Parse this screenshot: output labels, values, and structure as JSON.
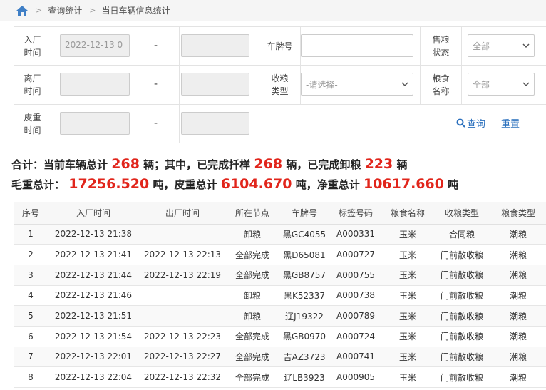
{
  "breadcrumb": {
    "items": [
      "查询统计",
      "当日车辆信息统计"
    ]
  },
  "filters": {
    "entry_time": {
      "label": "入厂时间",
      "from_value": "2022-12-13 0",
      "to_value": ""
    },
    "exit_time": {
      "label": "离厂时间",
      "from_value": "",
      "to_value": ""
    },
    "tare_time": {
      "label": "皮重时间",
      "from_value": "",
      "to_value": ""
    },
    "range_sep": "-",
    "plate": {
      "label": "车牌号",
      "value": ""
    },
    "grain_type_recv": {
      "label": "收粮类型",
      "placeholder": "-请选择-"
    },
    "sale_status": {
      "label": "售粮状态",
      "value": "全部"
    },
    "grain_name": {
      "label": "粮食名称",
      "value": "全部"
    },
    "query_label": "查询",
    "reset_label": "重置"
  },
  "summary": {
    "p1": "合计：当前车辆总计",
    "total_vehicles": "268",
    "u1": "辆；其中，已完成扦样",
    "sampled": "268",
    "u2": "辆，已完成卸粮",
    "unloaded": "223",
    "u3": "辆",
    "p2": "毛重总计：",
    "gross": "17256.520",
    "u4": "吨，皮重总计",
    "tare": "6104.670",
    "u5": "吨，净重总计",
    "net": "10617.660",
    "u6": "吨"
  },
  "table": {
    "headers": [
      "序号",
      "入厂时间",
      "出厂时间",
      "所在节点",
      "车牌号",
      "标签号码",
      "粮食名称",
      "收粮类型",
      "粮食类型"
    ],
    "rows": [
      [
        "1",
        "2022-12-13 21:38",
        "",
        "卸粮",
        "黑GC4055",
        "A000331",
        "玉米",
        "合同粮",
        "潮粮"
      ],
      [
        "2",
        "2022-12-13 21:41",
        "2022-12-13 22:13",
        "全部完成",
        "黑D65081",
        "A000727",
        "玉米",
        "门前散收粮",
        "潮粮"
      ],
      [
        "3",
        "2022-12-13 21:44",
        "2022-12-13 22:19",
        "全部完成",
        "黑GB8757",
        "A000755",
        "玉米",
        "门前散收粮",
        "潮粮"
      ],
      [
        "4",
        "2022-12-13 21:46",
        "",
        "卸粮",
        "黑K52337",
        "A000738",
        "玉米",
        "门前散收粮",
        "潮粮"
      ],
      [
        "5",
        "2022-12-13 21:51",
        "",
        "卸粮",
        "辽J19322",
        "A000789",
        "玉米",
        "门前散收粮",
        "潮粮"
      ],
      [
        "6",
        "2022-12-13 21:54",
        "2022-12-13 22:23",
        "全部完成",
        "黑GB0970",
        "A000724",
        "玉米",
        "门前散收粮",
        "潮粮"
      ],
      [
        "7",
        "2022-12-13 22:01",
        "2022-12-13 22:27",
        "全部完成",
        "吉AZ3723",
        "A000741",
        "玉米",
        "门前散收粮",
        "潮粮"
      ],
      [
        "8",
        "2022-12-13 22:04",
        "2022-12-13 22:32",
        "全部完成",
        "辽LB3923",
        "A000905",
        "玉米",
        "门前散收粮",
        "潮粮"
      ]
    ]
  },
  "colors": {
    "accent": "#2a6fbd",
    "highlight": "#e1251b"
  }
}
